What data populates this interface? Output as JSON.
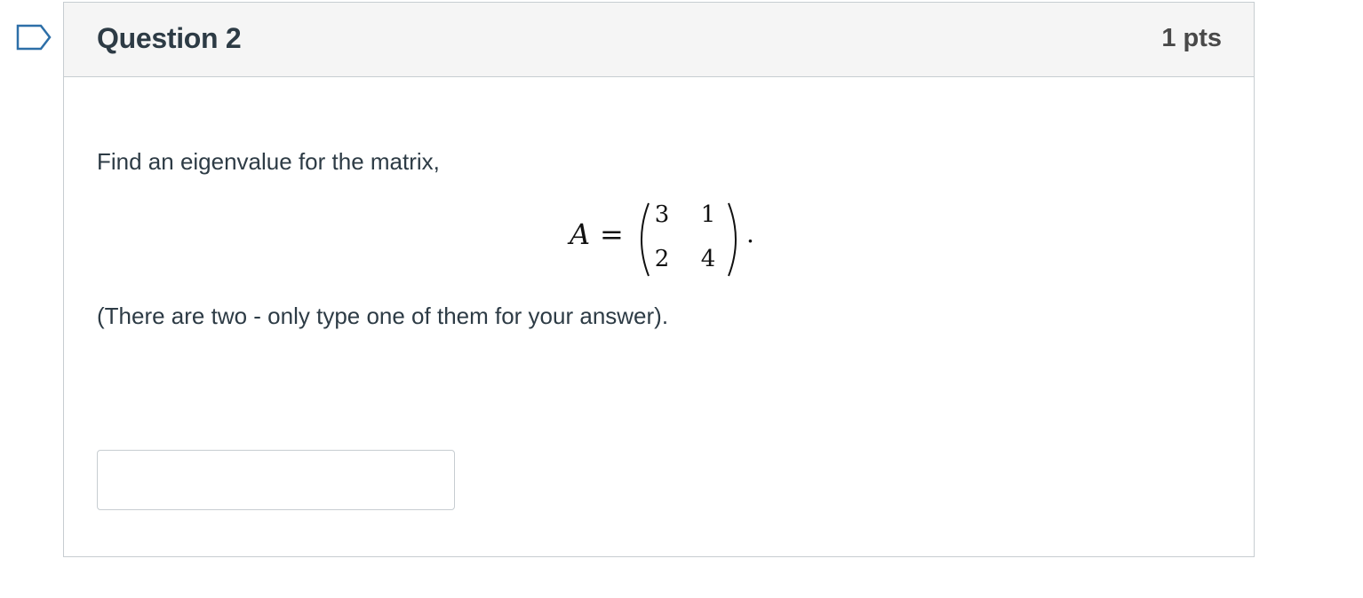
{
  "question": {
    "title": "Question 2",
    "points": "1 pts",
    "prompt": "Find an eigenvalue for the matrix,",
    "equation": {
      "lhs": "A",
      "equals": "=",
      "matrix": [
        [
          "3",
          "1"
        ],
        [
          "2",
          "4"
        ]
      ],
      "trailing": "."
    },
    "note": "(There are two - only type one of them for your answer).",
    "answer": {
      "value": "",
      "placeholder": ""
    }
  },
  "colors": {
    "header_bg": "#f5f5f5",
    "border": "#c7cdd1",
    "text": "#2d3b45",
    "flag_stroke": "#2d6fa8"
  },
  "icons": {
    "flag": "flag-outline-icon"
  }
}
